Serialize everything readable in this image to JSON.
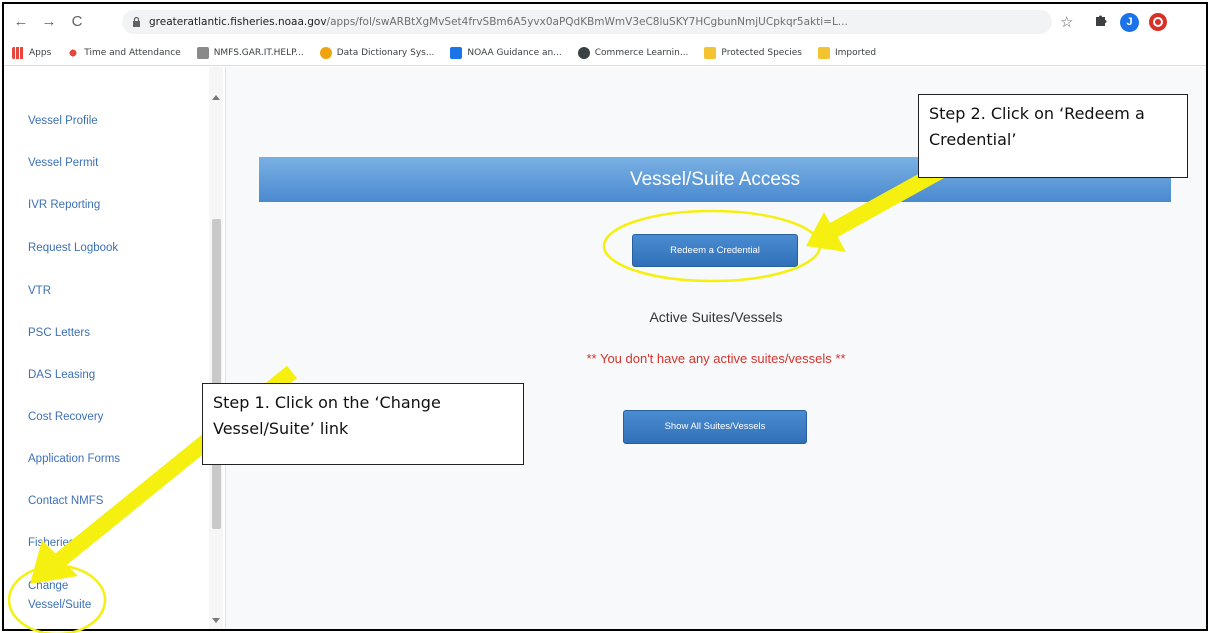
{
  "browser": {
    "url_host": "greateratlantic.fisheries.noaa.gov",
    "url_rest": "/apps/fol/swARBtXgMvSet4frvSBm6A5yvx0aPQdKBmWmV3eC8luSKY7HCgbunNmjUCpkqr5akti=L...",
    "nav_back": "←",
    "nav_forward": "→",
    "nav_reload": "C",
    "star_icon": "☆",
    "profile_initial": "J",
    "bookmarks": [
      {
        "label": "Apps",
        "color": "#e8453c"
      },
      {
        "label": "Time and Attendance",
        "color": "#e8453c"
      },
      {
        "label": "NMFS.GAR.IT.HELP...",
        "color": "#8a8a8a"
      },
      {
        "label": "Data Dictionary Sys...",
        "color": "#f0a30a"
      },
      {
        "label": "NOAA Guidance an...",
        "color": "#1a73e8"
      },
      {
        "label": "Commerce Learnin...",
        "color": "#3c4043"
      },
      {
        "label": "Protected Species",
        "color": "#f4c430"
      },
      {
        "label": "Imported",
        "color": "#f4c430"
      }
    ]
  },
  "sidebar": {
    "items": [
      "Vessel Profile",
      "Vessel Permit",
      "IVR Reporting",
      "Request Logbook",
      "VTR",
      "PSC Letters",
      "DAS Leasing",
      "Cost Recovery",
      "Application Forms",
      "Contact NMFS",
      "Fisheries"
    ],
    "change_label": "Change Vessel/Suite"
  },
  "main": {
    "banner_title": "Vessel/Suite Access",
    "redeem_button": "Redeem a Credential",
    "active_heading": "Active Suites/Vessels",
    "no_active_message": "** You don't have any active suites/vessels **",
    "show_all_button": "Show All Suites/Vessels"
  },
  "annotations": {
    "step1": "Step 1. Click on the ‘Change Vessel/Suite’ link",
    "step2": "Step 2. Click on ‘Redeem a Credential’"
  },
  "colors": {
    "link": "#3d70b8",
    "banner": "#5b9bd8",
    "button": "#3a7cc4",
    "warning": "#d8322c",
    "highlight": "#f5f010"
  }
}
